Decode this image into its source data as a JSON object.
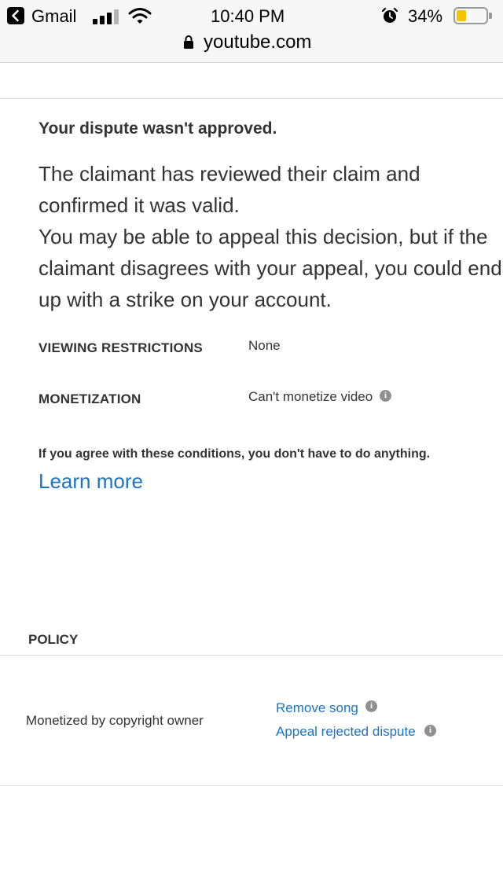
{
  "status_bar": {
    "back_app": "Gmail",
    "time": "10:40 PM",
    "battery_text": "34%",
    "battery_level": 0.34,
    "battery_color": "#f5c400"
  },
  "url_bar": {
    "domain": "youtube.com",
    "lock_icon": "lock-icon"
  },
  "dispute": {
    "heading": "Your dispute wasn't approved.",
    "body_lines": [
      "The claimant has reviewed their claim and",
      "confirmed it was valid.",
      "You may be able to appeal this decision, but if the",
      "claimant disagrees with your appeal, you could end",
      "up with a strike on your account."
    ]
  },
  "details": {
    "viewing_label": "VIEWING RESTRICTIONS",
    "viewing_value": "None",
    "monetization_label": "MONETIZATION",
    "monetization_value": "Can't monetize video"
  },
  "note": "If you agree with these conditions, you don't have to do anything.",
  "learn_more": "Learn more",
  "policy": {
    "heading": "POLICY",
    "description": "Monetized by copyright owner",
    "remove_song": "Remove song",
    "appeal": "Appeal rejected dispute"
  },
  "colors": {
    "link": "#1a73c8",
    "text": "#333333",
    "divider": "#dcdcdc"
  }
}
